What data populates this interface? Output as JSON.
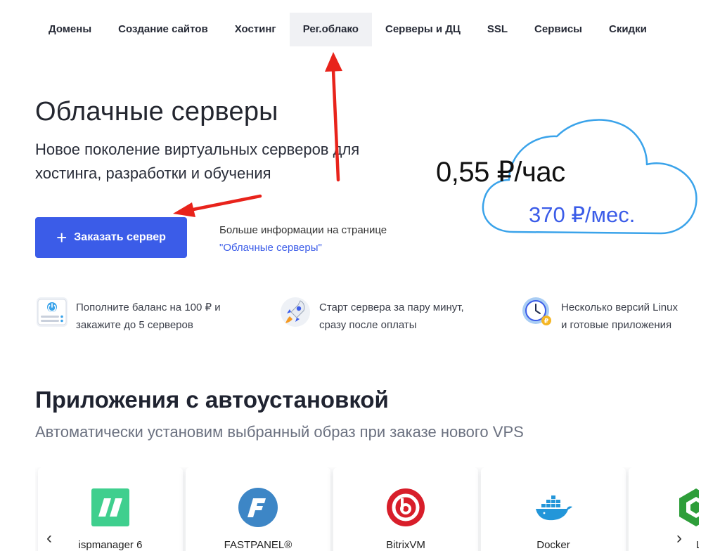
{
  "nav": {
    "items": [
      "Домены",
      "Создание сайтов",
      "Хостинг",
      "Рег.облако",
      "Серверы и ДЦ",
      "SSL",
      "Сервисы",
      "Скидки"
    ],
    "active_index": 3
  },
  "hero": {
    "title": "Облачные серверы",
    "subtitle": "Новое поколение виртуальных серверов для хостинга, разработки и обучения",
    "order_button": "Заказать сервер",
    "more_info_text": "Больше информации на странице",
    "more_info_link": "\"Облачные серверы\""
  },
  "pricing": {
    "per_hour": "0,55 ₽/час",
    "per_month": "370 ₽/мес."
  },
  "features": [
    {
      "icon": "server-power-icon",
      "line1": "Пополните баланс на 100 ₽ и",
      "line2": "закажите до 5 серверов"
    },
    {
      "icon": "rocket-icon",
      "line1": "Старт сервера за пару минут,",
      "line2": "сразу после оплаты"
    },
    {
      "icon": "clock-icon",
      "line1": "Несколько версий Linux",
      "line2": "и готовые приложения"
    }
  ],
  "apps": {
    "title": "Приложения с автоустановкой",
    "subtitle": "Автоматически установим выбранный образ при заказе нового VPS",
    "items": [
      {
        "name": "ispmanager 6",
        "icon": "ispmanager-logo"
      },
      {
        "name": "FASTPANEL®",
        "icon": "fastpanel-logo"
      },
      {
        "name": "BitrixVM",
        "icon": "bitrix-logo"
      },
      {
        "name": "Docker",
        "icon": "docker-logo"
      },
      {
        "name": "LE",
        "icon": "lemp-logo"
      }
    ]
  },
  "colors": {
    "accent": "#3b5ce8",
    "annotation_arrow": "#e8231b"
  }
}
